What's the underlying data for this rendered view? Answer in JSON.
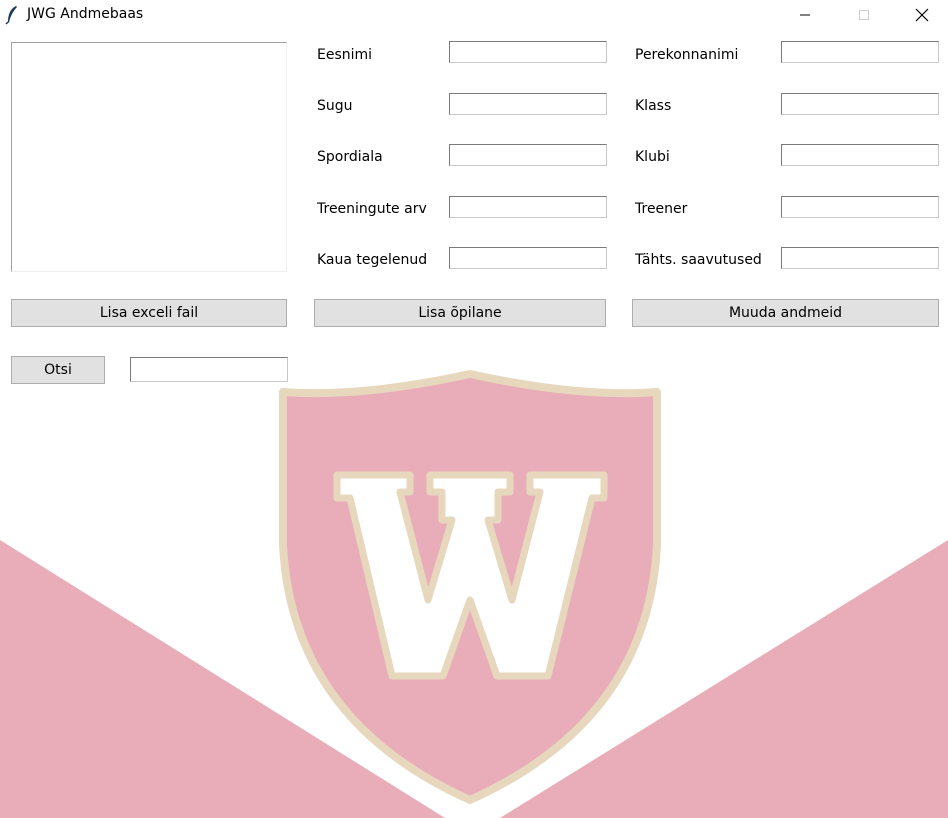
{
  "window": {
    "title": "JWG Andmebaas"
  },
  "form": {
    "fields": [
      {
        "label": "Eesnimi",
        "value": ""
      },
      {
        "label": "Perekonnanimi",
        "value": ""
      },
      {
        "label": "Sugu",
        "value": ""
      },
      {
        "label": "Klass",
        "value": ""
      },
      {
        "label": "Spordiala",
        "value": ""
      },
      {
        "label": "Klubi",
        "value": ""
      },
      {
        "label": "Treeningute arv",
        "value": ""
      },
      {
        "label": "Treener",
        "value": ""
      },
      {
        "label": "Kaua tegelenud",
        "value": ""
      },
      {
        "label": "Tähts. saavutused",
        "value": ""
      }
    ]
  },
  "buttons": {
    "add_excel": "Lisa exceli fail",
    "add_student": "Lisa õpilane",
    "edit_data": "Muuda andmeid",
    "search": "Otsi"
  },
  "search": {
    "value": ""
  },
  "icons": {
    "app": "feather-icon",
    "minimize": "minimize-icon",
    "maximize": "maximize-icon",
    "close": "close-icon",
    "emblem": "w-shield-emblem"
  },
  "colors": {
    "pink": "#e9adb9",
    "shield_border": "#e6d7bd",
    "button_bg": "#e1e1e1"
  }
}
